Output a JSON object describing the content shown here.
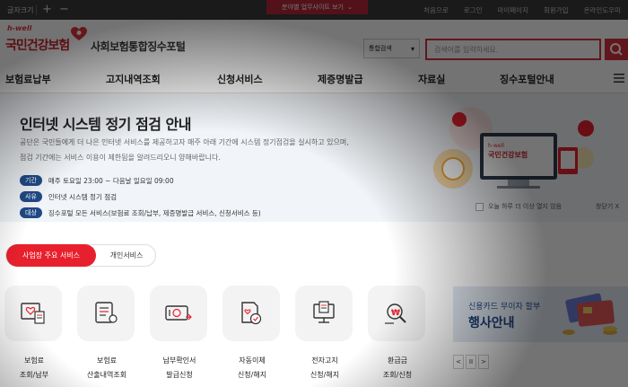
{
  "topbar": {
    "font_size_label": "글자크기",
    "plus": "+",
    "minus": "−",
    "center_label": "분야별 업무사이트 보기",
    "links": [
      "처음으로",
      "로그인",
      "마이페이지",
      "회원가입",
      "온라인도우미"
    ]
  },
  "header": {
    "logo_hwell": "h-well",
    "logo_main": "국민건강보험",
    "portal_name": "사회보험통합징수포털",
    "search_scope": "통합검색",
    "search_placeholder": "검색어를 입력하세요."
  },
  "nav": {
    "items": [
      "보험료납부",
      "고지내역조회",
      "신청서비스",
      "제증명발급",
      "자료실",
      "징수포털안내"
    ]
  },
  "notice": {
    "title": "인터넷 시스템 정기 점검 안내",
    "desc1": "공단은 국민들에게 더 나은 인터넷 서비스를 제공하고자 매주 아래 기간에 시스템 정기점검을 실시하고 있으며,",
    "desc2": "점검 기간에는 서비스 이용이 제한됨을 알려드리오니 양해바랍니다.",
    "rows": [
      {
        "tag": "기간",
        "text": "매주 토요일 23:00 ~ 다음날 일요일 09:00"
      },
      {
        "tag": "사유",
        "text": "인터넷 시스템 정기 점검"
      },
      {
        "tag": "대상",
        "text": "징수포털 모든 서비스(보험료 조회/납부, 제증명발급 서비스, 신청서비스 등)"
      }
    ],
    "no_show_today": "오늘 하루 더 이상 열지 않음",
    "close": "창닫기 X"
  },
  "service_tabs": {
    "active": "사업장 주요 서비스",
    "inactive": "개인서비스"
  },
  "services": [
    {
      "label": "보험료\n조회/납부",
      "icon": "bill-inquiry-icon"
    },
    {
      "label": "보험료\n산출내역조회",
      "icon": "calculation-icon"
    },
    {
      "label": "납부확인서\n발급신청",
      "icon": "payment-certificate-icon"
    },
    {
      "label": "자동이체\n신청/해지",
      "icon": "auto-transfer-icon"
    },
    {
      "label": "전자고지\n신청/해지",
      "icon": "e-notice-icon"
    },
    {
      "label": "환급금\n조회/신청",
      "icon": "refund-icon"
    }
  ],
  "side_banner": {
    "line1": "신용카드 무이자 할부",
    "line2": "행사안내",
    "pager": [
      "<",
      "II",
      ">"
    ]
  },
  "colors": {
    "brand_red": "#e8202d",
    "navy": "#1f4a86"
  }
}
